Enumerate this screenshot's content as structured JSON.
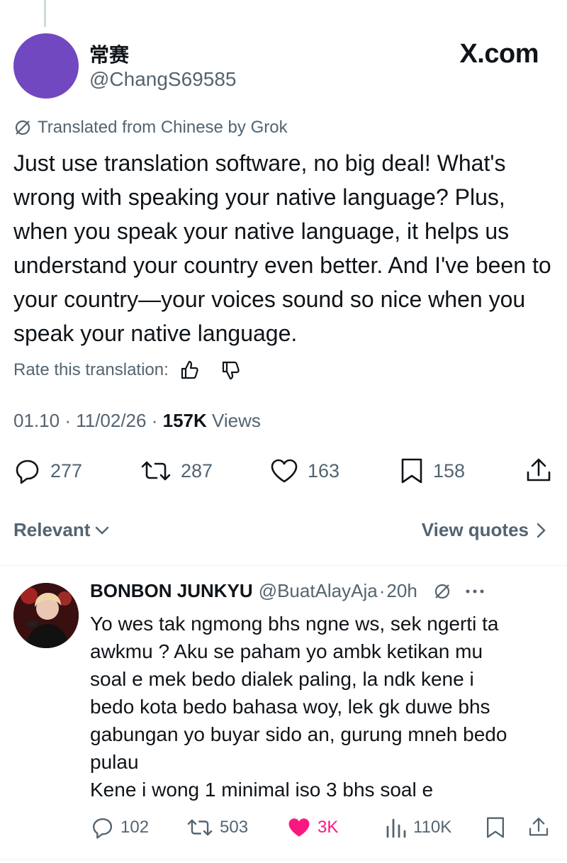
{
  "post": {
    "display_name": "常赛",
    "handle": "@ChangS69585",
    "brand": "X.com",
    "translated_label": "Translated from Chinese by Grok",
    "text": "Just use translation software, no big deal! What's wrong with speaking your native language? Plus, when you speak your native language, it helps us understand your country even better. And I've been to your country—your voices sound so nice when you speak your native language.",
    "rate_label": "Rate this translation:",
    "time": "01.10",
    "date": "11/02/26",
    "views_count": "157K",
    "views_label": "Views",
    "stats": {
      "replies": "277",
      "reposts": "287",
      "likes": "163",
      "bookmarks": "158"
    }
  },
  "sort": {
    "relevant_label": "Relevant",
    "view_quotes_label": "View quotes"
  },
  "reply": {
    "display_name": "BONBON JUNKYU",
    "handle": "@BuatAlayAja",
    "time": "20h",
    "lines": [
      "Yo wes tak ngmong bhs ngne ws, sek ngerti ta",
      "awkmu ? Aku se paham yo ambk ketikan mu",
      "soal e mek bedo dialek paling, la ndk kene i",
      "bedo kota bedo bahasa woy, lek gk duwe bhs",
      "gabungan yo buyar sido an, gurung mneh bedo",
      "pulau",
      "Kene i wong 1 minimal iso 3 bhs soal e"
    ],
    "stats": {
      "replies": "102",
      "reposts": "503",
      "likes": "3K",
      "views": "110K"
    }
  },
  "colors": {
    "text": "#0f1419",
    "secondary": "#536471",
    "like": "#f91880",
    "avatar": "#7248c0"
  },
  "icons": [
    "grok-icon",
    "thumbs-up-icon",
    "thumbs-down-icon",
    "reply-icon",
    "repost-icon",
    "like-icon",
    "bookmark-icon",
    "share-icon",
    "chevron-down-icon",
    "chevron-right-icon",
    "more-icon",
    "views-icon"
  ]
}
